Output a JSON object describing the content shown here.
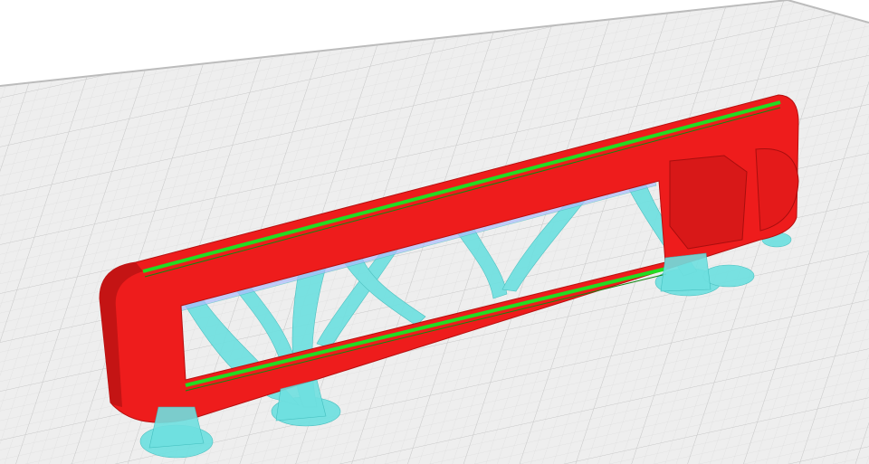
{
  "viewport": {
    "view": "3d-layer-preview",
    "colors": {
      "background": "#ffffff",
      "build_plate": "#ececec",
      "grid": "#d4d4d4",
      "wall": "#ee1c1c",
      "wall_shade": "#b81010",
      "infill_top": "#22dd22",
      "support": "#66dede"
    }
  }
}
